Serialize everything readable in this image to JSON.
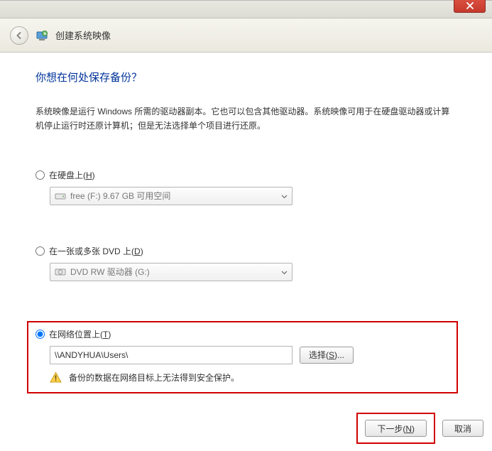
{
  "window": {
    "title": "创建系统映像"
  },
  "heading": "你想在何处保存备份？",
  "description": "系统映像是运行 Windows 所需的驱动器副本。它也可以包含其他驱动器。系统映像可用于在硬盘驱动器或计算机停止运行时还原计算机；但是无法选择单个项目进行还原。",
  "options": {
    "hdd": {
      "label_pre": "在硬盘上(",
      "hotkey": "H",
      "label_post": ")",
      "value": "free (F:)  9.67 GB 可用空间"
    },
    "dvd": {
      "label_pre": "在一张或多张 DVD 上(",
      "hotkey": "D",
      "label_post": ")",
      "value": "DVD RW 驱动器 (G:)"
    },
    "network": {
      "label_pre": "在网络位置上(",
      "hotkey": "T",
      "label_post": ")",
      "path": "\\\\ANDYHUA\\Users\\",
      "select_label_pre": "选择(",
      "select_hotkey": "S",
      "select_label_post": ")...",
      "warning": "备份的数据在网络目标上无法得到安全保护。"
    }
  },
  "footer": {
    "next_pre": "下一步(",
    "next_hotkey": "N",
    "next_post": ")",
    "cancel": "取消"
  }
}
